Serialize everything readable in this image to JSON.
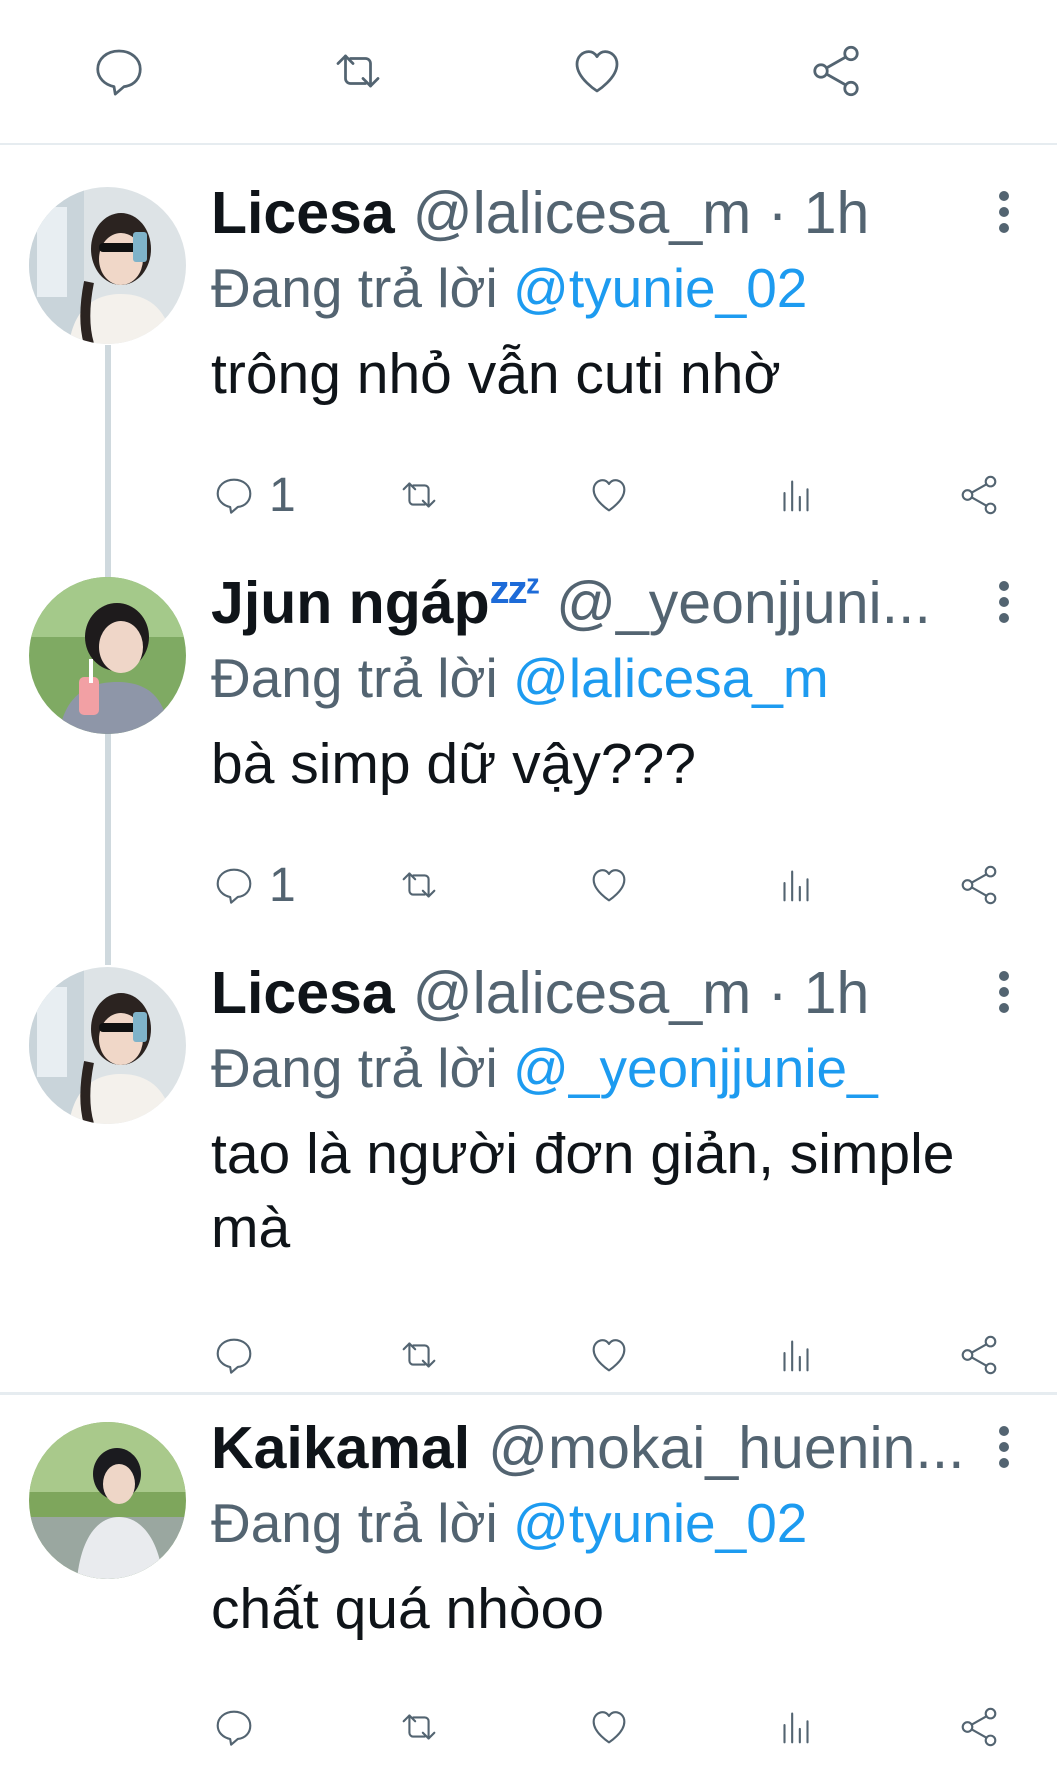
{
  "top_actions": [
    "reply",
    "retweet",
    "like",
    "share"
  ],
  "tweets": [
    {
      "name": "Licesa",
      "name_suffix": "",
      "handle": "@lalicesa_m · 1h",
      "replying_prefix": "Đang trả lời",
      "replying_to": "@tyunie_02",
      "text": "trông nhỏ vẫn cuti nhờ",
      "reply_count": "1"
    },
    {
      "name": "Jjun ngáp",
      "name_suffix": "zzᶻ",
      "handle": "@_yeonjjuni...",
      "replying_prefix": "Đang trả lời",
      "replying_to": "@lalicesa_m",
      "text": "bà simp dữ vậy???",
      "reply_count": "1"
    },
    {
      "name": "Licesa",
      "name_suffix": "",
      "handle": "@lalicesa_m · 1h",
      "replying_prefix": "Đang trả lời",
      "replying_to": "@_yeonjjunie_",
      "text": "tao là người đơn giản, simple mà",
      "reply_count": ""
    },
    {
      "name": "Kaikamal",
      "name_suffix": "",
      "handle": "@mokai_huenin...",
      "replying_prefix": "Đang trả lời",
      "replying_to": "@tyunie_02",
      "text": "chất quá nhòoo",
      "reply_count": ""
    }
  ],
  "colors": {
    "text": "#0f1419",
    "secondary": "#536471",
    "link": "#1d9bf0",
    "divider": "#e6ecf0",
    "thread_line": "#cfd9de"
  }
}
